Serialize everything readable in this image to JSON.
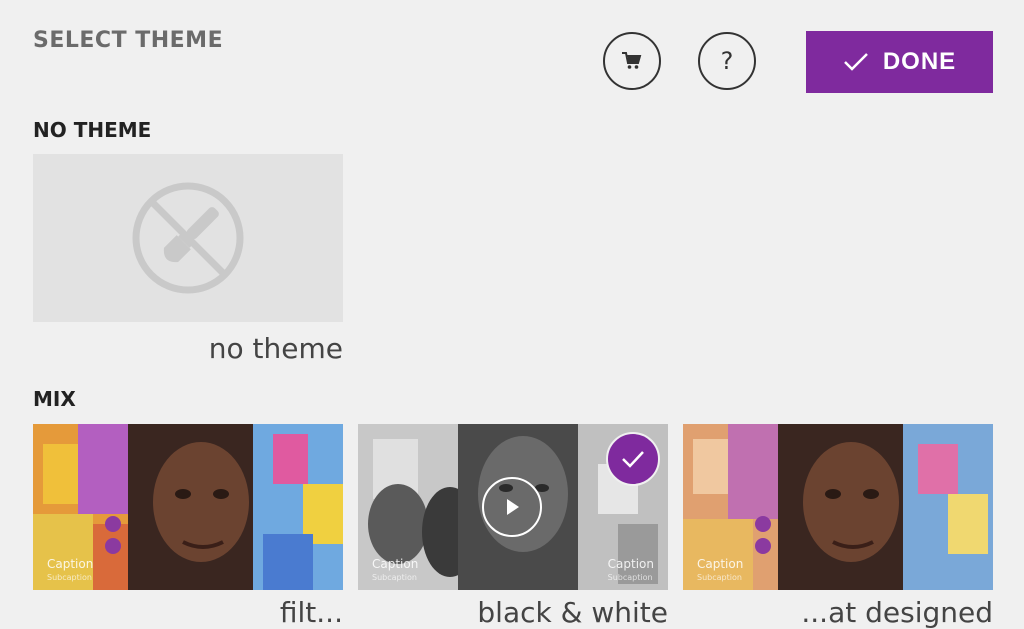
{
  "header": {
    "title": "SELECT THEME",
    "help_label": "?",
    "done_label": "DONE"
  },
  "icons": {
    "store": "shopping-cart-icon",
    "help": "question-icon",
    "done": "checkmark-icon",
    "no_theme": "no-brush-icon",
    "play": "play-icon",
    "selected": "checkmark-icon"
  },
  "sections": {
    "no_theme": {
      "label": "NO THEME",
      "tile_caption": "no theme"
    },
    "mix": {
      "label": "MIX",
      "tiles": [
        {
          "caption_title": "Caption",
          "caption_sub": "Subcaption",
          "name": "filt...",
          "selected": false
        },
        {
          "caption_title": "Caption",
          "caption_sub": "Subcaption",
          "name": "black & white",
          "selected": true
        },
        {
          "caption_title": "Caption",
          "caption_sub": "Subcaption",
          "name": "...at designed",
          "selected": false
        }
      ]
    }
  },
  "colors": {
    "accent": "#7f2a9e",
    "background": "#f0f0f0"
  }
}
